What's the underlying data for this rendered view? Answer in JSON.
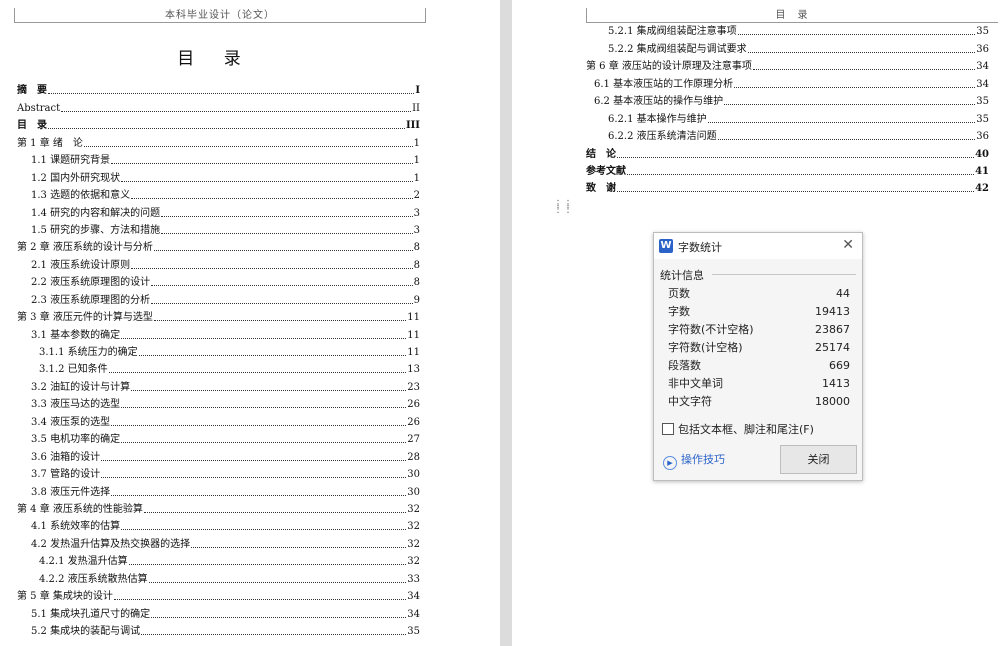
{
  "left_page": {
    "header": "本科毕业设计（论文）",
    "title": "目 录",
    "entries": [
      {
        "label": "摘　要",
        "page": "I",
        "level": 0,
        "bold": true
      },
      {
        "label": "Abstract",
        "page": "II",
        "level": 0,
        "bold": false
      },
      {
        "label": "目　录",
        "page": "III",
        "level": 0,
        "bold": true
      },
      {
        "label": "第 1 章  绪　论",
        "page": "1",
        "level": 0,
        "bold": false
      },
      {
        "label": "1.1  课题研究背景",
        "page": "1",
        "level": 1,
        "bold": false
      },
      {
        "label": "1.2  国内外研究现状",
        "page": "1",
        "level": 1,
        "bold": false
      },
      {
        "label": "1.3  选题的依据和意义",
        "page": "2",
        "level": 1,
        "bold": false
      },
      {
        "label": "1.4  研究的内容和解决的问题",
        "page": "3",
        "level": 1,
        "bold": false
      },
      {
        "label": "1.5  研究的步骤、方法和措施",
        "page": "3",
        "level": 1,
        "bold": false
      },
      {
        "label": "第 2 章  液压系统的设计与分析",
        "page": "8",
        "level": 0,
        "bold": false
      },
      {
        "label": "2.1  液压系统设计原则",
        "page": "8",
        "level": 1,
        "bold": false
      },
      {
        "label": "2.2  液压系统原理图的设计",
        "page": "8",
        "level": 1,
        "bold": false
      },
      {
        "label": "2.3  液压系统原理图的分析",
        "page": "9",
        "level": 1,
        "bold": false
      },
      {
        "label": "第 3 章  液压元件的计算与选型",
        "page": "11",
        "level": 0,
        "bold": false
      },
      {
        "label": "3.1  基本参数的确定",
        "page": "11",
        "level": 1,
        "bold": false
      },
      {
        "label": "3.1.1  系统压力的确定",
        "page": "11",
        "level": 2,
        "bold": false
      },
      {
        "label": "3.1.2  已知条件",
        "page": "13",
        "level": 2,
        "bold": false
      },
      {
        "label": "3.2  油缸的设计与计算",
        "page": "23",
        "level": 1,
        "bold": false
      },
      {
        "label": "3.3  液压马达的选型",
        "page": "26",
        "level": 1,
        "bold": false
      },
      {
        "label": "3.4  液压泵的选型",
        "page": "26",
        "level": 1,
        "bold": false
      },
      {
        "label": "3.5  电机功率的确定",
        "page": "27",
        "level": 1,
        "bold": false
      },
      {
        "label": "3.6  油箱的设计",
        "page": "28",
        "level": 1,
        "bold": false
      },
      {
        "label": "3.7  管路的设计",
        "page": "30",
        "level": 1,
        "bold": false
      },
      {
        "label": "3.8  液压元件选择",
        "page": "30",
        "level": 1,
        "bold": false
      },
      {
        "label": "第 4 章  液压系统的性能验算",
        "page": "32",
        "level": 0,
        "bold": false
      },
      {
        "label": "4.1  系统效率的估算",
        "page": "32",
        "level": 1,
        "bold": false
      },
      {
        "label": "4.2  发热温升估算及热交换器的选择",
        "page": "32",
        "level": 1,
        "bold": false
      },
      {
        "label": "4.2.1  发热温升估算",
        "page": "32",
        "level": 2,
        "bold": false
      },
      {
        "label": "4.2.2  液压系统散热估算",
        "page": "33",
        "level": 2,
        "bold": false
      },
      {
        "label": "第 5 章  集成块的设计",
        "page": "34",
        "level": 0,
        "bold": false
      },
      {
        "label": "5.1  集成块孔道尺寸的确定",
        "page": "34",
        "level": 1,
        "bold": false
      },
      {
        "label": "5.2  集成块的装配与调试",
        "page": "35",
        "level": 1,
        "bold": false
      }
    ]
  },
  "right_page": {
    "header": "目　录",
    "entries": [
      {
        "label": "5.2.1  集成阀组装配注意事项",
        "page": "35",
        "level": 3,
        "bold": false
      },
      {
        "label": "5.2.2  集成阀组装配与调试要求",
        "page": "36",
        "level": 3,
        "bold": false
      },
      {
        "label": "第 6 章  液压站的设计原理及注意事项",
        "page": "34",
        "level": 0,
        "bold": false
      },
      {
        "label": "6.1  基本液压站的工作原理分析",
        "page": "34",
        "level": 4,
        "bold": false
      },
      {
        "label": "6.2  基本液压站的操作与维护",
        "page": "35",
        "level": 4,
        "bold": false
      },
      {
        "label": "6.2.1  基本操作与维护",
        "page": "35",
        "level": 3,
        "bold": false
      },
      {
        "label": "6.2.2  液压系统清洁问题",
        "page": "36",
        "level": 3,
        "bold": false
      },
      {
        "label": "结　论",
        "page": "40",
        "level": 0,
        "bold": true
      },
      {
        "label": "参考文献",
        "page": "41",
        "level": 0,
        "bold": true
      },
      {
        "label": "致　谢",
        "page": "42",
        "level": 0,
        "bold": true
      }
    ]
  },
  "dialog": {
    "logo": "W",
    "title": "字数统计",
    "close_glyph": "✕",
    "section_label": "统计信息",
    "stats": [
      {
        "label": "页数",
        "value": "44"
      },
      {
        "label": "字数",
        "value": "19413"
      },
      {
        "label": "字符数(不计空格)",
        "value": "23867"
      },
      {
        "label": "字符数(计空格)",
        "value": "25174"
      },
      {
        "label": "段落数",
        "value": "669"
      },
      {
        "label": "非中文单词",
        "value": "1413"
      },
      {
        "label": "中文字符",
        "value": "18000"
      }
    ],
    "checkbox_label": "包括文本框、脚注和尾注(F)",
    "checkbox_checked": false,
    "tips_label": "操作技巧",
    "close_button": "关闭"
  },
  "icons": {
    "drag_handle": "drag-handle-icon",
    "tips": "play-circle-icon",
    "close": "close-icon",
    "logo": "wps-writer-logo"
  },
  "colors": {
    "accent": "#2b62c8",
    "page_bg": "#ffffff",
    "workspace_bg": "#e6e6e6"
  }
}
